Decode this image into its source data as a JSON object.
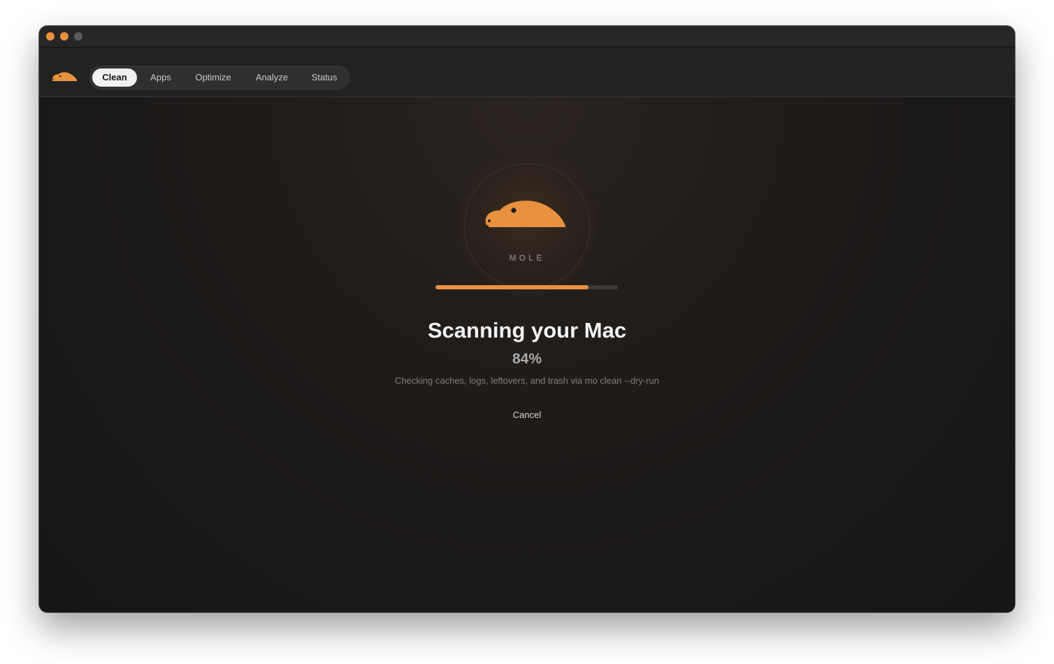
{
  "window": {
    "controls": [
      "close",
      "minimize",
      "zoom"
    ]
  },
  "app": {
    "logo_icon": "mole-icon",
    "accent_color": "#e8913e"
  },
  "tabs": [
    {
      "label": "Clean",
      "active": true
    },
    {
      "label": "Apps",
      "active": false
    },
    {
      "label": "Optimize",
      "active": false
    },
    {
      "label": "Analyze",
      "active": false
    },
    {
      "label": "Status",
      "active": false
    }
  ],
  "scan": {
    "brand_label": "MOLE",
    "title": "Scanning your Mac",
    "percent_text": "84%",
    "progress": 0.84,
    "subtitle": "Checking caches, logs, leftovers, and trash via mo clean --dry-run",
    "cancel_label": "Cancel"
  }
}
